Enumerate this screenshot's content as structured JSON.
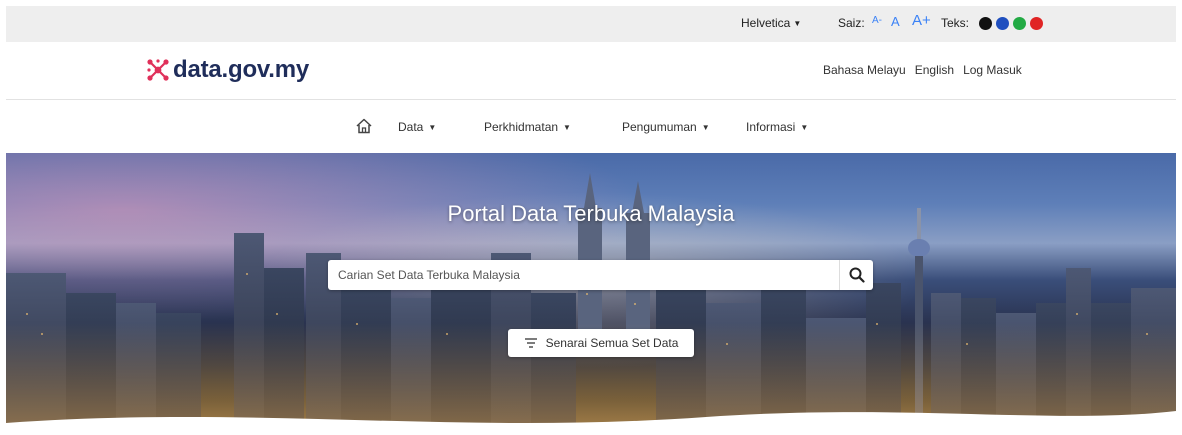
{
  "topbar": {
    "font_dropdown": "Helvetica",
    "size_label": "Saiz:",
    "size_options": [
      "A-",
      "A",
      "A+"
    ],
    "text_label": "Teks:",
    "text_colors": [
      "#111111",
      "#1f4fbf",
      "#22aa44",
      "#e02424"
    ]
  },
  "header": {
    "logo_text": "data.gov.my",
    "links": [
      "Bahasa Melayu",
      "English",
      "Log Masuk"
    ]
  },
  "nav": {
    "items": [
      {
        "label": "Data"
      },
      {
        "label": "Perkhidmatan"
      },
      {
        "label": "Pengumuman"
      },
      {
        "label": "Informasi"
      }
    ]
  },
  "hero": {
    "title": "Portal Data Terbuka Malaysia",
    "search_placeholder": "Carian Set Data Terbuka Malaysia",
    "list_button_label": "Senarai Semua Set Data"
  },
  "colors": {
    "logo": "#1f2d5a",
    "logo_mark": "#e0305a",
    "size_accent": "#3b82f6"
  }
}
